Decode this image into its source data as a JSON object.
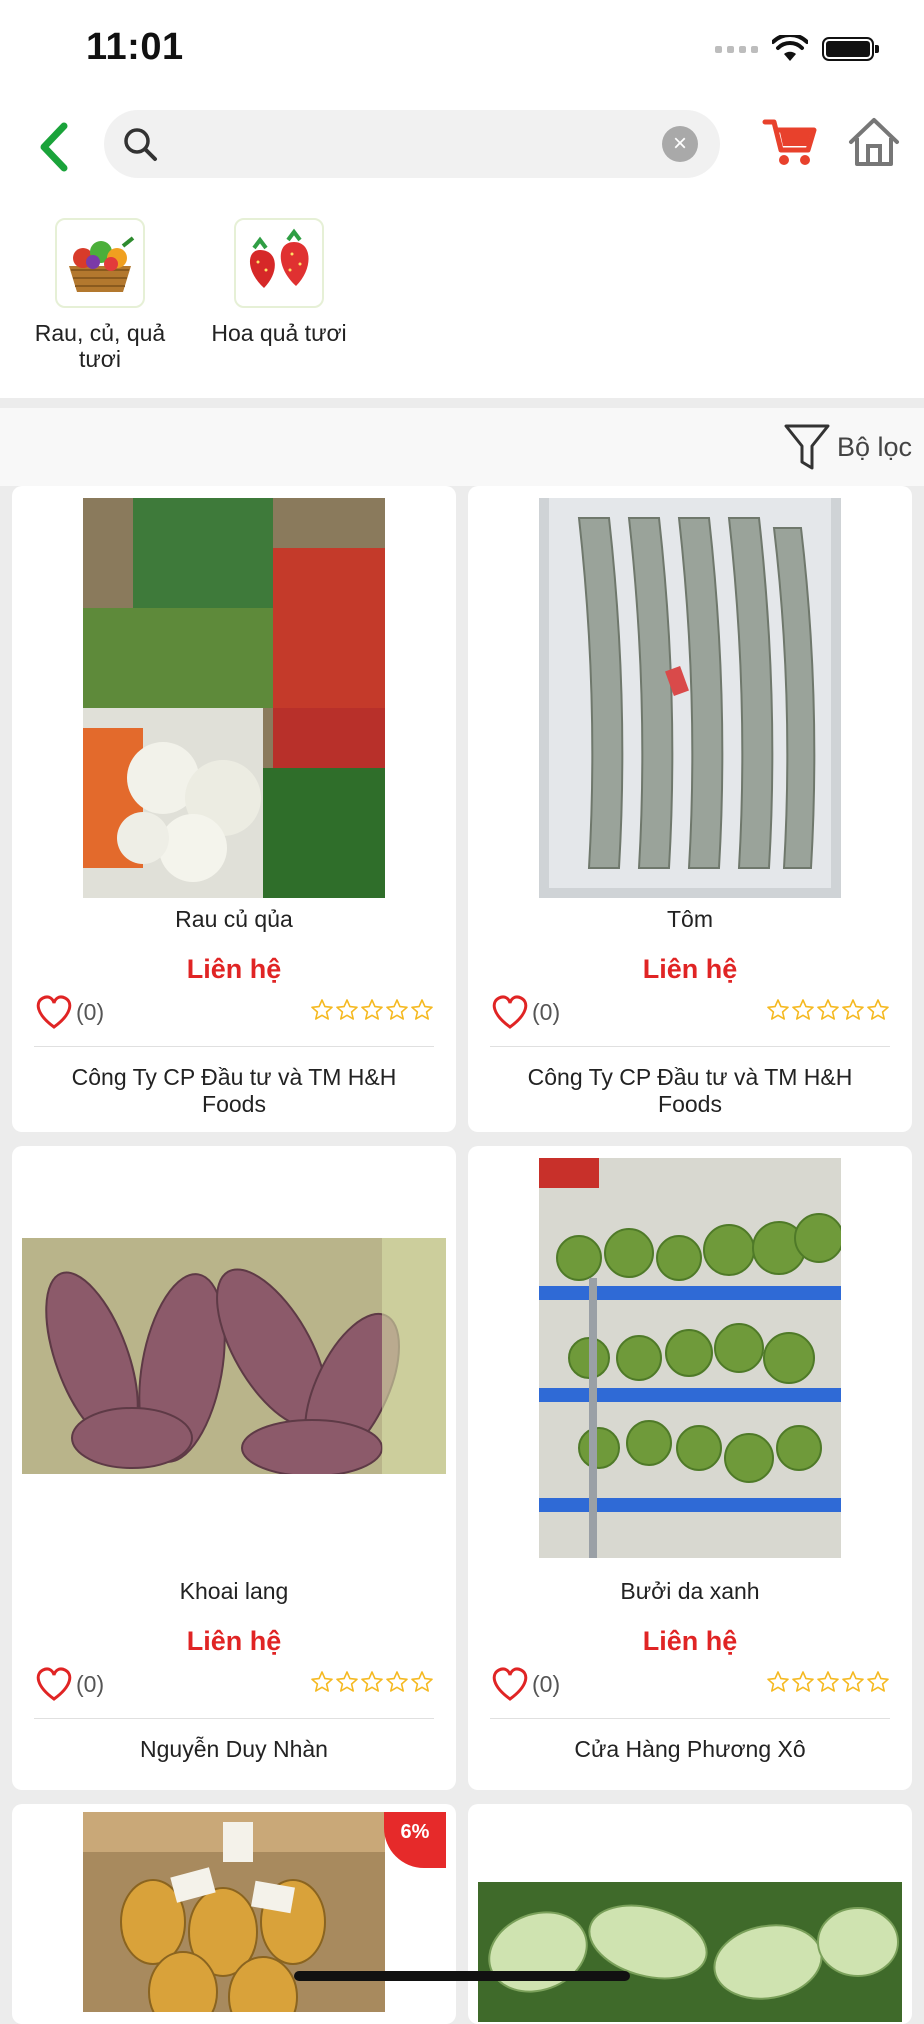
{
  "status": {
    "time": "11:01"
  },
  "search": {
    "placeholder": "",
    "value": ""
  },
  "categories": [
    {
      "label": "Rau, củ, quả tươi"
    },
    {
      "label": "Hoa quả tươi"
    }
  ],
  "filter": {
    "label": "Bộ lọc"
  },
  "products": [
    {
      "name": "Rau củ qủa",
      "price": "Liên hệ",
      "likes": "(0)",
      "shop": "Công Ty CP Đầu tư và TM H&H Foods",
      "rating": 0
    },
    {
      "name": "Tôm",
      "price": "Liên hệ",
      "likes": "(0)",
      "shop": "Công Ty CP Đầu tư và TM H&H Foods",
      "rating": 0
    },
    {
      "name": "Khoai lang",
      "price": "Liên hệ",
      "likes": "(0)",
      "shop": "Nguyễn Duy Nhàn",
      "rating": 0
    },
    {
      "name": "Bưởi da xanh",
      "price": "Liên hệ",
      "likes": "(0)",
      "shop": "Cửa Hàng Phương Xô",
      "rating": 0
    },
    {
      "discount": "6%"
    },
    {}
  ],
  "colors": {
    "accent_green": "#1aa33a",
    "price_red": "#e02424",
    "cart_red": "#e8412c",
    "star": "#f5b921"
  },
  "icons": {
    "back": "chevron-left-icon",
    "search": "search-icon",
    "clear": "clear-icon",
    "cart": "cart-icon",
    "home": "home-icon",
    "filter": "filter-icon",
    "like": "heart-icon",
    "star": "star-icon"
  }
}
